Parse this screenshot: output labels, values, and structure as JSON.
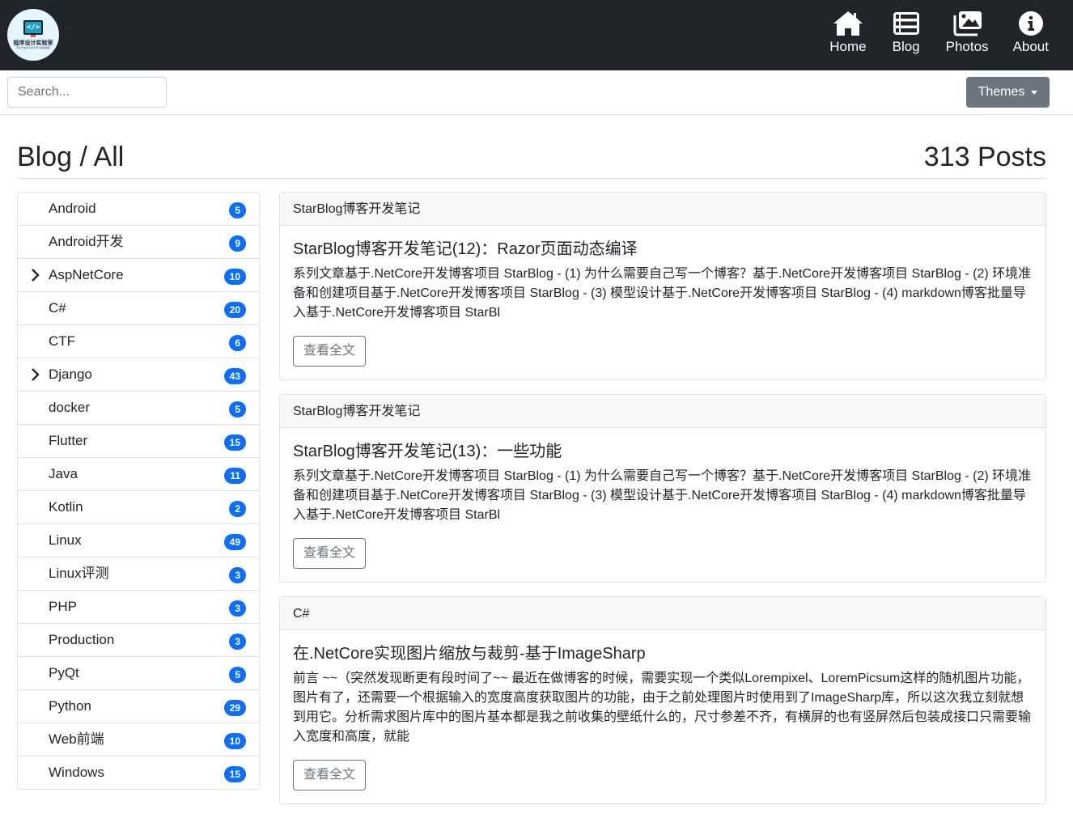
{
  "logo": {
    "name": "程序设计实验室",
    "tagline": "专注于技术分享与学习的实验室"
  },
  "nav": {
    "items": [
      {
        "label": "Home",
        "icon": "home-icon"
      },
      {
        "label": "Blog",
        "icon": "list-icon"
      },
      {
        "label": "Photos",
        "icon": "images-icon"
      },
      {
        "label": "About",
        "icon": "info-circle-icon"
      }
    ]
  },
  "toolbar": {
    "search_placeholder": "Search...",
    "search_value": "",
    "themes_label": "Themes"
  },
  "page": {
    "title": "Blog / All",
    "post_count": "313 Posts"
  },
  "categories": [
    {
      "name": "Android",
      "count": "5",
      "expandable": false
    },
    {
      "name": "Android开发",
      "count": "9",
      "expandable": false
    },
    {
      "name": "AspNetCore",
      "count": "10",
      "expandable": true
    },
    {
      "name": "C#",
      "count": "20",
      "expandable": false
    },
    {
      "name": "CTF",
      "count": "6",
      "expandable": false
    },
    {
      "name": "Django",
      "count": "43",
      "expandable": true
    },
    {
      "name": "docker",
      "count": "5",
      "expandable": false
    },
    {
      "name": "Flutter",
      "count": "15",
      "expandable": false
    },
    {
      "name": "Java",
      "count": "11",
      "expandable": false
    },
    {
      "name": "Kotlin",
      "count": "2",
      "expandable": false
    },
    {
      "name": "Linux",
      "count": "49",
      "expandable": false
    },
    {
      "name": "Linux评测",
      "count": "3",
      "expandable": false
    },
    {
      "name": "PHP",
      "count": "3",
      "expandable": false
    },
    {
      "name": "Production",
      "count": "3",
      "expandable": false
    },
    {
      "name": "PyQt",
      "count": "5",
      "expandable": false
    },
    {
      "name": "Python",
      "count": "29",
      "expandable": false
    },
    {
      "name": "Web前端",
      "count": "10",
      "expandable": false
    },
    {
      "name": "Windows",
      "count": "15",
      "expandable": false
    }
  ],
  "posts": [
    {
      "category": "StarBlog博客开发笔记",
      "title": "StarBlog博客开发笔记(12)：Razor页面动态编译",
      "summary": "系列文章基于.NetCore开发博客项目 StarBlog - (1) 为什么需要自己写一个博客？基于.NetCore开发博客项目 StarBlog - (2) 环境准备和创建项目基于.NetCore开发博客项目 StarBlog - (3) 模型设计基于.NetCore开发博客项目 StarBlog - (4) markdown博客批量导入基于.NetCore开发博客项目 StarBl",
      "button": "查看全文"
    },
    {
      "category": "StarBlog博客开发笔记",
      "title": "StarBlog博客开发笔记(13)：一些功能",
      "summary": "系列文章基于.NetCore开发博客项目 StarBlog - (1) 为什么需要自己写一个博客？基于.NetCore开发博客项目 StarBlog - (2) 环境准备和创建项目基于.NetCore开发博客项目 StarBlog - (3) 模型设计基于.NetCore开发博客项目 StarBlog - (4) markdown博客批量导入基于.NetCore开发博客项目 StarBl",
      "button": "查看全文"
    },
    {
      "category": "C#",
      "title": "在.NetCore实现图片缩放与裁剪-基于ImageSharp",
      "summary": "前言 ~~（突然发现断更有段时间了~~ 最近在做博客的时候，需要实现一个类似Lorempixel、LoremPicsum这样的随机图片功能，图片有了，还需要一个根据输入的宽度高度获取图片的功能，由于之前处理图片时使用到了ImageSharp库，所以这次我立刻就想到用它。分析需求图片库中的图片基本都是我之前收集的壁纸什么的，尺寸参差不齐，有横屏的也有竖屏然后包装成接口只需要输入宽度和高度，就能",
      "button": "查看全文"
    }
  ],
  "colors": {
    "navbar_bg": "#212529",
    "badge": "#0d6efd",
    "themes_button": "#6c757d",
    "card_header_bg": "#f7f7f7"
  }
}
